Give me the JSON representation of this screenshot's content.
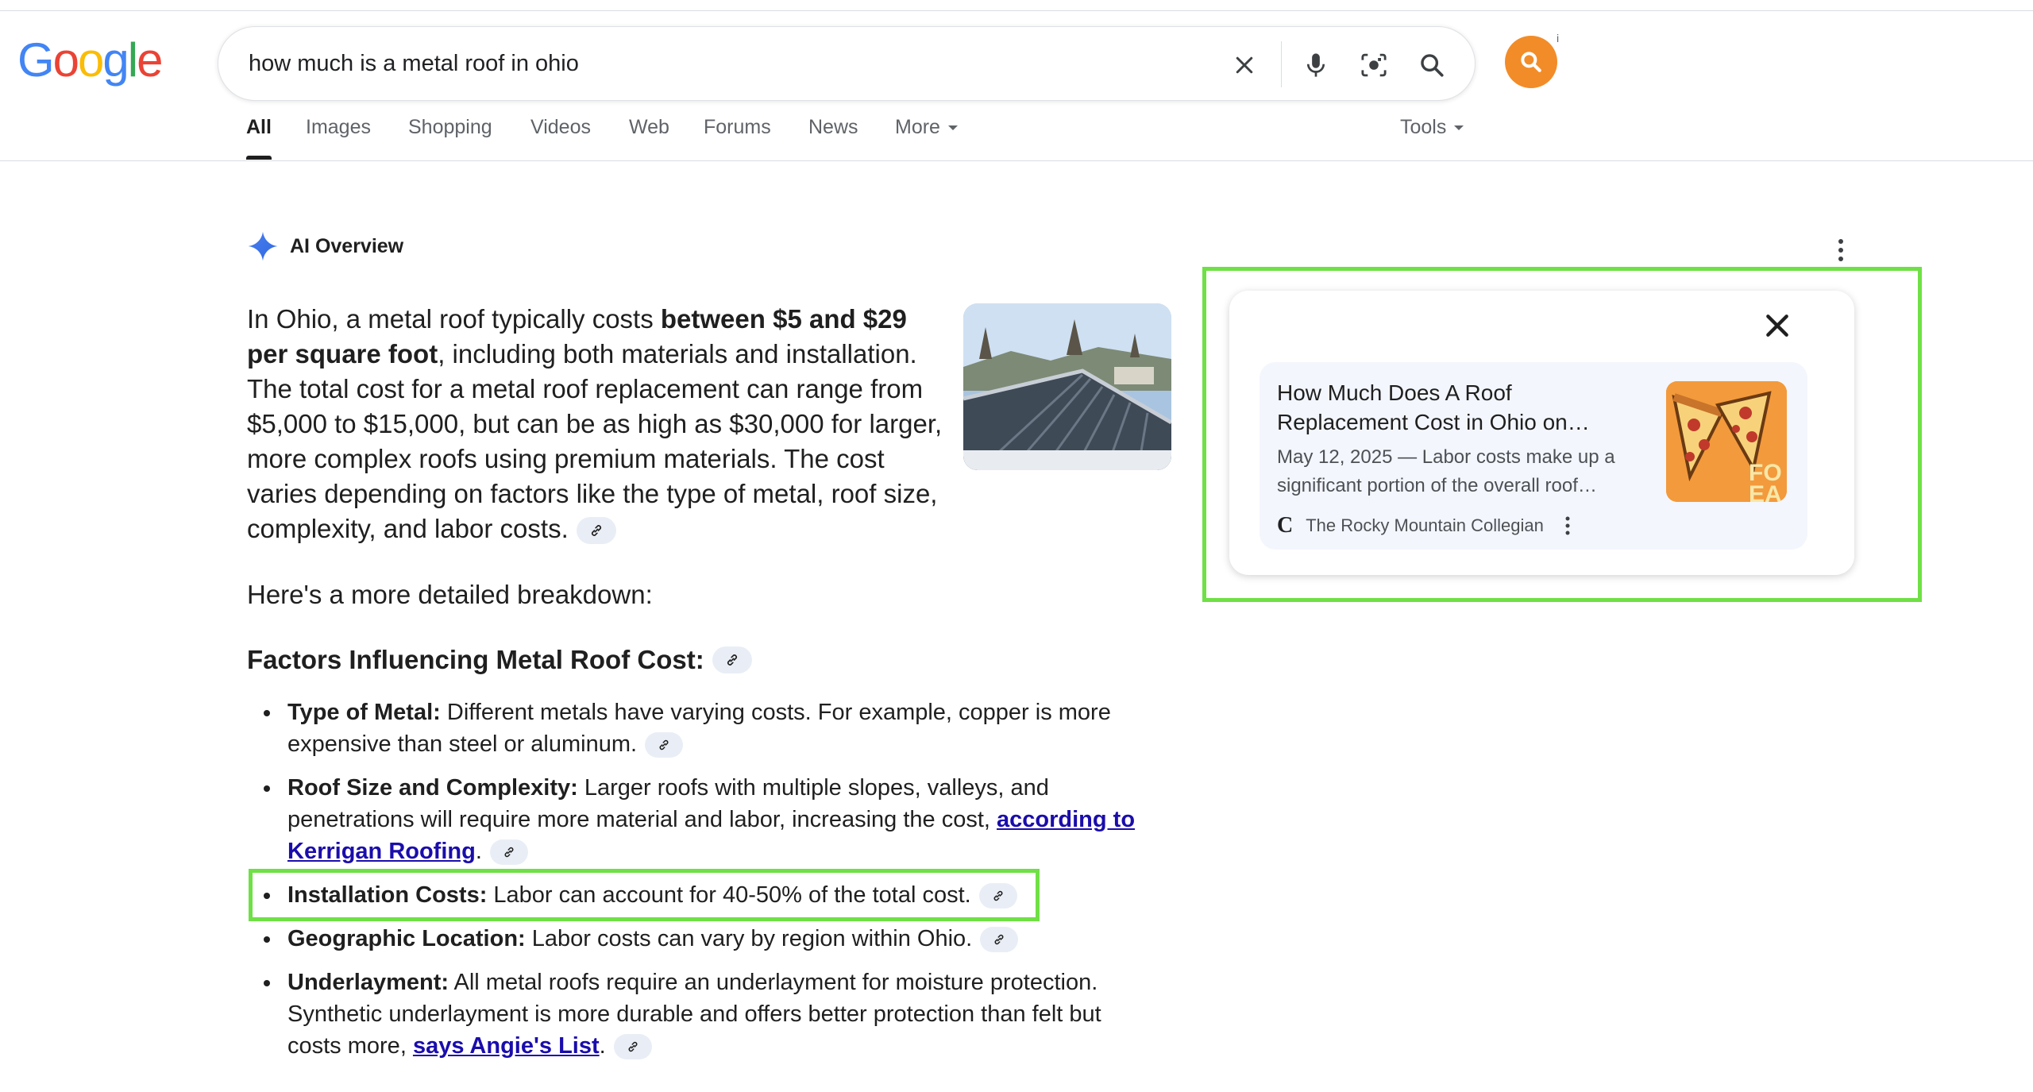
{
  "search": {
    "query": "how much is a metal roof in ohio"
  },
  "logo": {
    "letters": [
      "G",
      "o",
      "o",
      "g",
      "l",
      "e"
    ],
    "colors": [
      "#4285F4",
      "#EA4335",
      "#FBBC05",
      "#4285F4",
      "#34A853",
      "#EA4335"
    ]
  },
  "tabs": {
    "all": "All",
    "images": "Images",
    "shopping": "Shopping",
    "videos": "Videos",
    "web": "Web",
    "forums": "Forums",
    "news": "News",
    "more": "More",
    "tools": "Tools"
  },
  "ai_overview": {
    "title": "AI Overview",
    "intro_before": "In Ohio, a metal roof typically costs ",
    "intro_bold": "between $5 and $29 per square foot",
    "intro_after": ", including both materials and installation. The total cost for a metal roof replacement can range from $5,000 to $15,000, but can be as high as $30,000 for larger, more complex roofs using premium materials. The cost varies depending on factors like the type of metal, roof size, complexity, and labor costs.",
    "breakdown": "Here's a more detailed breakdown:",
    "factors_heading": "Factors Influencing Metal Roof Cost:",
    "bullets": [
      {
        "label": "Type of Metal:",
        "text": " Different metals have varying costs. For example, copper is more expensive than steel or aluminum."
      },
      {
        "label": "Roof Size and Complexity:",
        "text": " Larger roofs with multiple slopes, valleys, and penetrations will require more material and labor, increasing the cost, ",
        "link": "according to Kerrigan Roofing",
        "after": "."
      },
      {
        "label": "Installation Costs:",
        "text": " Labor can account for 40-50% of the total cost."
      },
      {
        "label": "Geographic Location:",
        "text": " Labor costs can vary by region within Ohio."
      },
      {
        "label": "Underlayment:",
        "text": " All metal roofs require an underlayment for moisture protection. Synthetic underlayment is more durable and offers better protection than felt but costs more, ",
        "link": "says Angie's List",
        "after": "."
      }
    ]
  },
  "source_card": {
    "title": "How Much Does A Roof Replacement Cost in Ohio on…",
    "snippet": "May 12, 2025 — Labor costs make up a significant portion of the overall roof…",
    "publisher": "The Rocky Mountain Collegian",
    "publisher_logo": "C",
    "thumb_text": "FO EA"
  },
  "colors": {
    "highlight": "#6fe045",
    "link": "#1a0dab",
    "avatar": "#f28c28",
    "chip": "#e9eef6"
  }
}
